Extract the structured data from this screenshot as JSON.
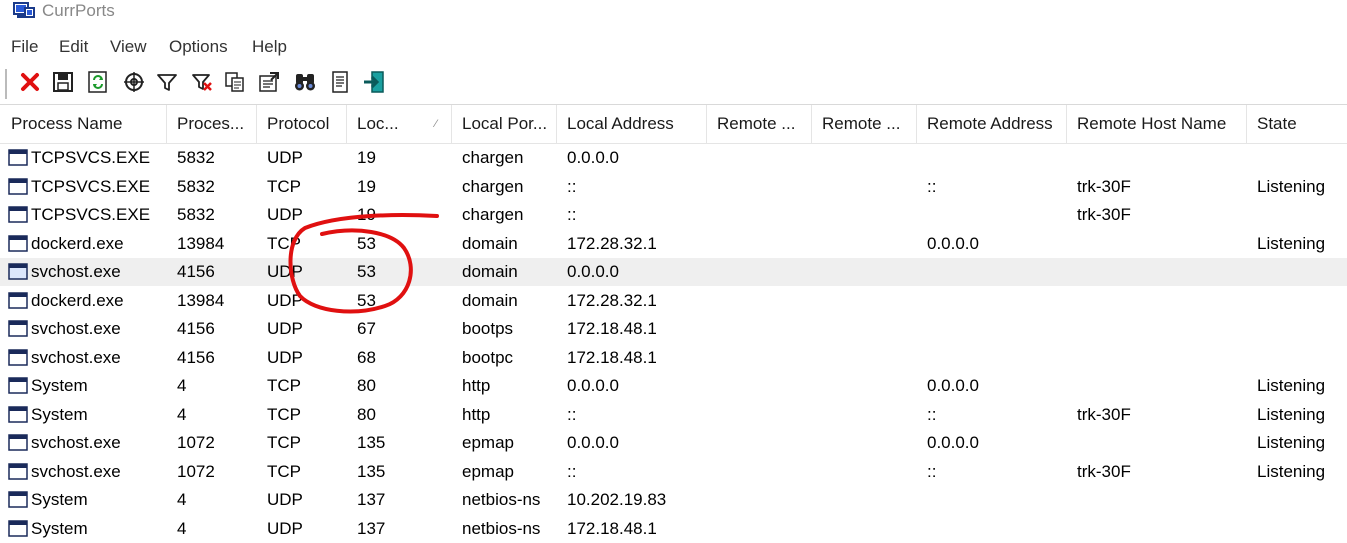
{
  "window": {
    "title": "CurrPorts",
    "icon": "currports-app-icon"
  },
  "menu": [
    "File",
    "Edit",
    "View",
    "Options",
    "Help"
  ],
  "toolbar": [
    {
      "name": "close-connections-icon"
    },
    {
      "name": "save-icon"
    },
    {
      "name": "refresh-icon"
    },
    {
      "name": "target-icon"
    },
    {
      "name": "filter-icon"
    },
    {
      "name": "clear-filter-icon"
    },
    {
      "name": "copy-icon"
    },
    {
      "name": "properties-icon"
    },
    {
      "name": "find-icon"
    },
    {
      "name": "html-report-icon"
    },
    {
      "name": "exit-icon"
    }
  ],
  "columns": [
    "Process Name",
    "Proces...",
    "Protocol",
    "Loc...",
    "Local Por...",
    "Local Address",
    "Remote ...",
    "Remote ...",
    "Remote Address",
    "Remote Host Name",
    "State"
  ],
  "rows": [
    [
      "TCPSVCS.EXE",
      "5832",
      "UDP",
      "19",
      "chargen",
      "0.0.0.0",
      "",
      "",
      "",
      "",
      ""
    ],
    [
      "TCPSVCS.EXE",
      "5832",
      "TCP",
      "19",
      "chargen",
      "::",
      "",
      "",
      "::",
      "trk-30F",
      "Listening"
    ],
    [
      "TCPSVCS.EXE",
      "5832",
      "UDP",
      "19",
      "chargen",
      "::",
      "",
      "",
      "",
      "trk-30F",
      ""
    ],
    [
      "dockerd.exe",
      "13984",
      "TCP",
      "53",
      "domain",
      "172.28.32.1",
      "",
      "",
      "0.0.0.0",
      "",
      "Listening"
    ],
    [
      "svchost.exe",
      "4156",
      "UDP",
      "53",
      "domain",
      "0.0.0.0",
      "",
      "",
      "",
      "",
      ""
    ],
    [
      "dockerd.exe",
      "13984",
      "UDP",
      "53",
      "domain",
      "172.28.32.1",
      "",
      "",
      "",
      "",
      ""
    ],
    [
      "svchost.exe",
      "4156",
      "UDP",
      "67",
      "bootps",
      "172.18.48.1",
      "",
      "",
      "",
      "",
      ""
    ],
    [
      "svchost.exe",
      "4156",
      "UDP",
      "68",
      "bootpc",
      "172.18.48.1",
      "",
      "",
      "",
      "",
      ""
    ],
    [
      "System",
      "4",
      "TCP",
      "80",
      "http",
      "0.0.0.0",
      "",
      "",
      "0.0.0.0",
      "",
      "Listening"
    ],
    [
      "System",
      "4",
      "TCP",
      "80",
      "http",
      "::",
      "",
      "",
      "::",
      "trk-30F",
      "Listening"
    ],
    [
      "svchost.exe",
      "1072",
      "TCP",
      "135",
      "epmap",
      "0.0.0.0",
      "",
      "",
      "0.0.0.0",
      "",
      "Listening"
    ],
    [
      "svchost.exe",
      "1072",
      "TCP",
      "135",
      "epmap",
      "::",
      "",
      "",
      "::",
      "trk-30F",
      "Listening"
    ],
    [
      "System",
      "4",
      "UDP",
      "137",
      "netbios-ns",
      "10.202.19.83",
      "",
      "",
      "",
      "",
      ""
    ],
    [
      "System",
      "4",
      "UDP",
      "137",
      "netbios-ns",
      "172.18.48.1",
      "",
      "",
      "",
      "",
      ""
    ]
  ],
  "selected_row": 4,
  "colors": {
    "annotation": "#e01010",
    "selected_row": "#efefef"
  }
}
